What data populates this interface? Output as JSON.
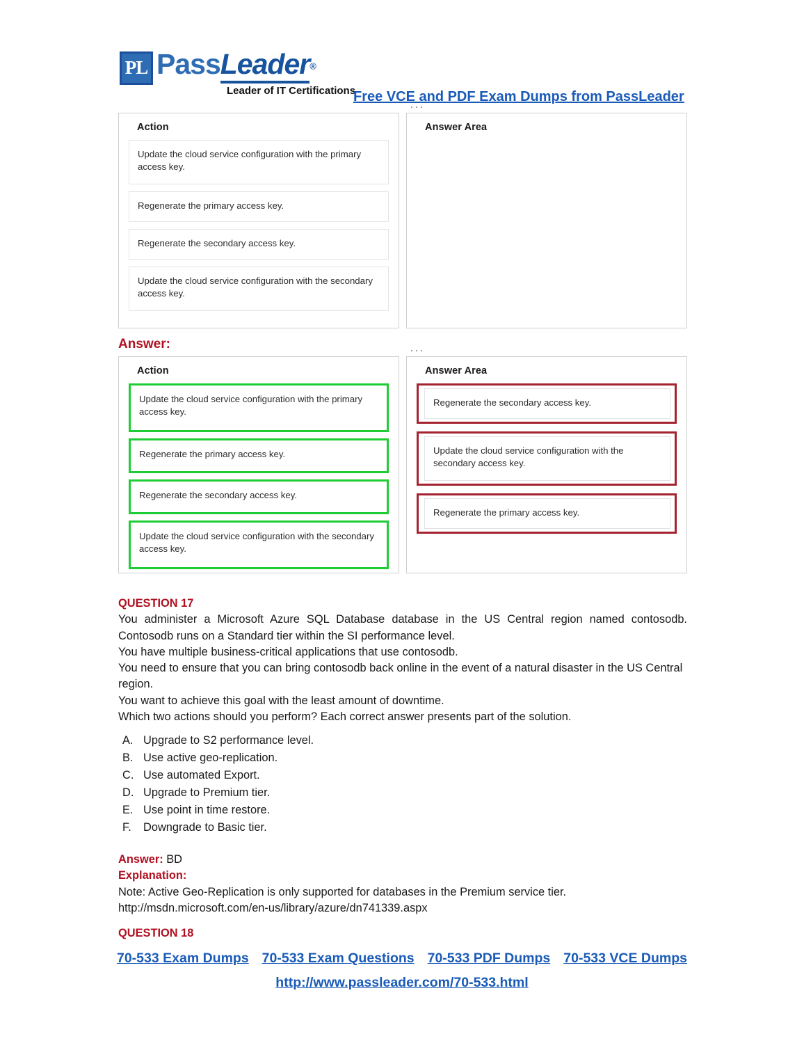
{
  "brand": {
    "monogram": "PL",
    "name_part1": "Pass",
    "name_part2": "Leader",
    "registered": "®",
    "tagline": "Leader of IT Certifications",
    "header_link": "Free VCE and PDF Exam Dumps from PassLeader",
    "accent_blue": "#1A5BB8",
    "logo_blue": "#2E6DB4"
  },
  "question_widget": {
    "action_panel_title": "Action",
    "answer_panel_title": "Answer Area",
    "actions": [
      "Update the cloud service configuration with the primary access key.",
      "Regenerate the primary access key.",
      "Regenerate the secondary access key.",
      "Update the cloud service configuration with the secondary access key."
    ],
    "answer_area_items": []
  },
  "answer_widget": {
    "label": "Answer:",
    "action_panel_title": "Action",
    "answer_panel_title": "Answer Area",
    "actions": [
      "Update the cloud service configuration with the primary access key.",
      "Regenerate the primary access key.",
      "Regenerate the secondary access key.",
      "Update the cloud service configuration with the secondary access key."
    ],
    "answer_area_items": [
      "Regenerate the secondary access key.",
      "Update the cloud service configuration with the secondary access key.",
      "Regenerate the primary access key."
    ],
    "highlight_action_color": "#1ECD35",
    "highlight_answer_color": "#A52330"
  },
  "question17": {
    "heading": "QUESTION 17",
    "paragraph": "You administer a Microsoft Azure SQL Database database in the US Central region named contosodb. Contosodb runs on a Standard tier within the SI performance level.",
    "lines": [
      "You have multiple business-critical applications that use contosodb.",
      "You need to ensure that you can bring contosodb back online in the event of a natural disaster in the US Central region.",
      "You want to achieve this goal with the least amount of downtime.",
      "Which two actions should you perform? Each correct answer presents part of the solution."
    ],
    "options": [
      {
        "key": "A.",
        "text": "Upgrade to S2 performance level."
      },
      {
        "key": "B.",
        "text": "Use active geo-replication."
      },
      {
        "key": "C.",
        "text": "Use automated Export."
      },
      {
        "key": "D.",
        "text": "Upgrade to Premium tier."
      },
      {
        "key": "E.",
        "text": "Use point in time restore."
      },
      {
        "key": "F.",
        "text": "Downgrade to Basic tier."
      }
    ],
    "answer_label": "Answer:",
    "answer_value": "BD",
    "explanation_label": "Explanation:",
    "explanation_note": "Note: Active Geo-Replication is only supported for databases in the Premium service tier.",
    "explanation_url": "http://msdn.microsoft.com/en-us/library/azure/dn741339.aspx"
  },
  "question18": {
    "heading": "QUESTION 18"
  },
  "footer": {
    "links": [
      "70-533 Exam Dumps",
      "70-533 Exam Questions",
      "70-533 PDF Dumps",
      "70-533 VCE Dumps"
    ],
    "url": "http://www.passleader.com/70-533.html"
  }
}
